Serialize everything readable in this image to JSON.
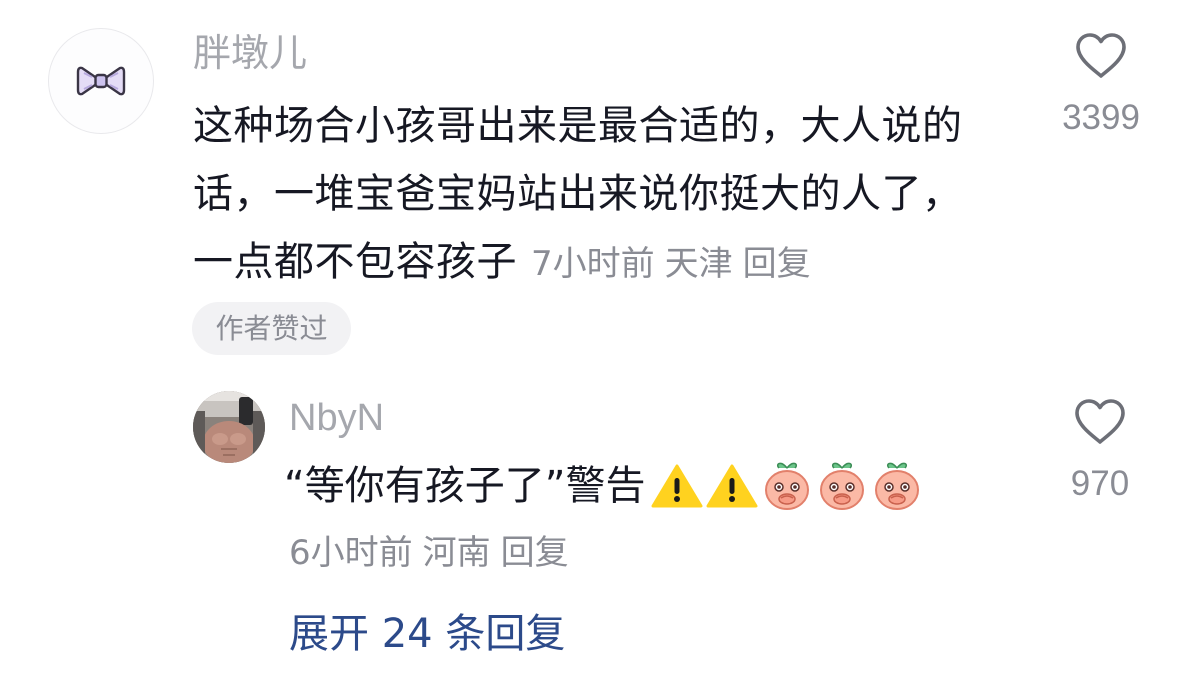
{
  "comment": {
    "author": "胖墩儿",
    "text_lines": [
      "这种场合小孩哥出来是最合适的，大人说的",
      "话，一堆宝爸宝妈站出来说你挺大的人了，",
      "一点都不包容孩子"
    ],
    "time": "7小时前",
    "location": "天津",
    "reply_label": "回复",
    "badge": "作者赞过",
    "like_count": "3399",
    "avatar_icon": "bow-tie-icon",
    "like_icon": "heart-outline-icon"
  },
  "reply": {
    "author": "NbyN",
    "text": "“等你有孩子了”警告",
    "emoji_icons": [
      "warning-icon",
      "warning-icon",
      "peach-face-icon",
      "peach-face-icon",
      "peach-face-icon"
    ],
    "time": "6小时前",
    "location": "河南",
    "reply_label": "回复",
    "like_count": "970",
    "avatar_icon": "user-photo-avatar",
    "like_icon": "heart-outline-icon"
  },
  "expand": {
    "label": "展开 24 条回复"
  },
  "colors": {
    "text": "#161823",
    "muted": "#8a8c94",
    "author": "#a5a7ad",
    "link": "#2c4a8a",
    "badge_bg": "#f2f2f4"
  }
}
